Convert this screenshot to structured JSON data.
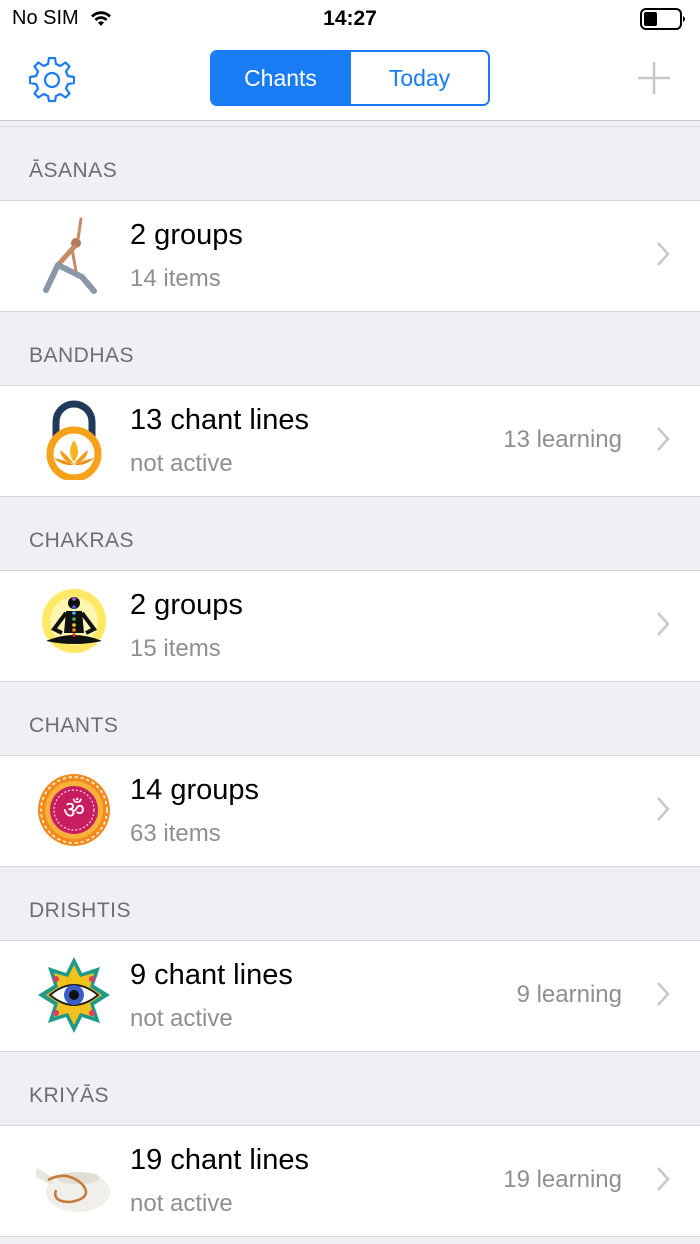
{
  "status_bar": {
    "carrier": "No SIM",
    "time": "14:27"
  },
  "nav": {
    "settings_icon": "gear-icon",
    "segments": [
      {
        "label": "Chants",
        "selected": true
      },
      {
        "label": "Today",
        "selected": false
      }
    ],
    "add_icon": "plus-icon"
  },
  "colors": {
    "accent": "#1a7cf5",
    "secondary_text": "#8e8e93",
    "background": "#efeff4"
  },
  "sections": [
    {
      "header": "ĀSANAS",
      "title": "2 groups",
      "subtitle": "14 items",
      "detail": "",
      "icon": "yoga-pose-image"
    },
    {
      "header": "BANDHAS",
      "title": "13 chant lines",
      "subtitle": "not active",
      "detail": "13 learning",
      "icon": "lock-lotus-image"
    },
    {
      "header": "CHAKRAS",
      "title": "2 groups",
      "subtitle": "15 items",
      "detail": "",
      "icon": "meditation-chakra-image"
    },
    {
      "header": "CHANTS",
      "title": "14 groups",
      "subtitle": "63 items",
      "detail": "",
      "icon": "om-mandala-image"
    },
    {
      "header": "DRISHTIS",
      "title": "9 chant lines",
      "subtitle": "not active",
      "detail": "9 learning",
      "icon": "eye-mandala-image"
    },
    {
      "header": "KRIYĀS",
      "title": "19 chant lines",
      "subtitle": "not active",
      "detail": "19 learning",
      "icon": "neti-pot-image"
    }
  ]
}
